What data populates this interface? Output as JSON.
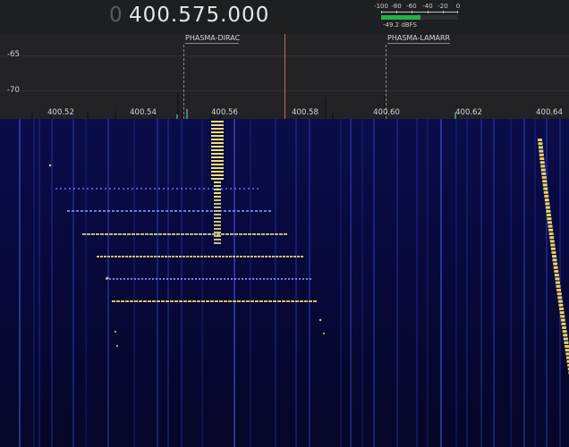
{
  "header": {
    "frequency_lead_digit": "0",
    "frequency": "400.575.000"
  },
  "level_meter": {
    "scale_labels": [
      "-100",
      "-80",
      "-60",
      "-40",
      "-20",
      "0"
    ],
    "readout": "-49.2 dBFS",
    "level_dbfs": -49.2,
    "bar_color": "#22b34a"
  },
  "spectrum": {
    "db_labels": [
      "-65",
      "-70"
    ],
    "freq_labels": [
      "400.52",
      "400.54",
      "400.56",
      "400.58",
      "400.60",
      "400.62",
      "400.64"
    ],
    "markers": [
      {
        "label": "PHASMA-DIRAC"
      },
      {
        "label": "PHASMA-LAMARR"
      }
    ],
    "center_line_color": "#c26a5a"
  },
  "waterfall": {
    "background_color": "#07083a",
    "signal_color": "#f2e06a"
  }
}
